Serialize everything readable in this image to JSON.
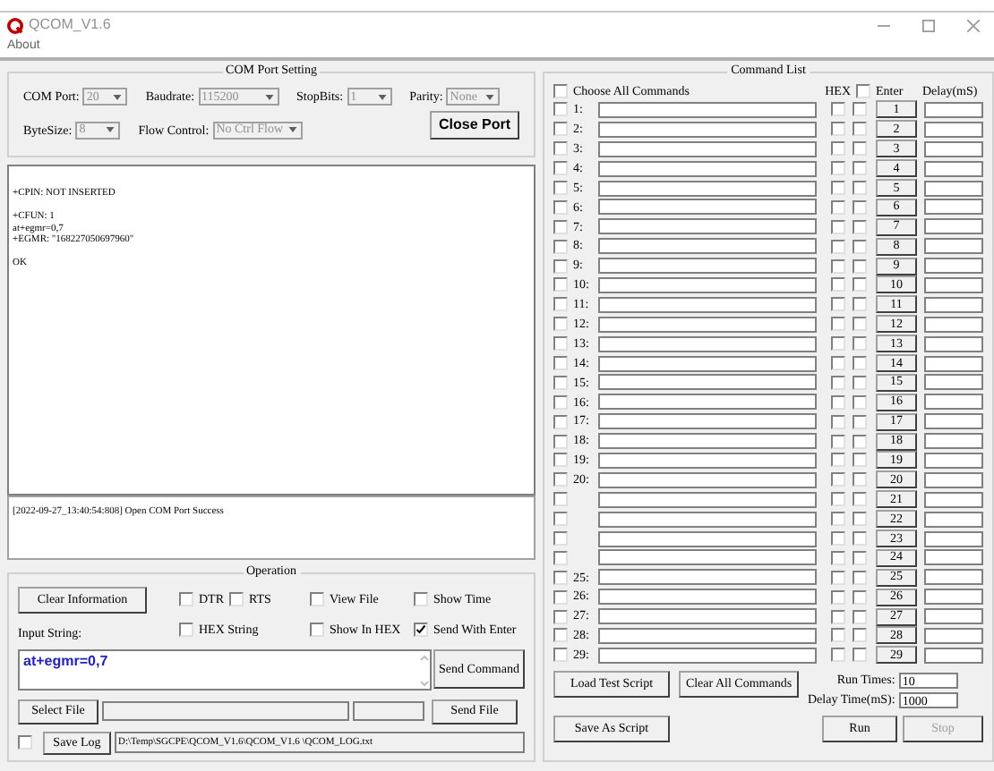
{
  "window": {
    "title": "QCOM_V1.6",
    "menu": [
      "About"
    ]
  },
  "com_port_setting": {
    "title": "COM Port Setting",
    "row1": [
      {
        "label": "COM Port:",
        "value": "20"
      },
      {
        "label": "Baudrate:",
        "value": "115200"
      },
      {
        "label": "StopBits:",
        "value": "1"
      },
      {
        "label": "Parity:",
        "value": "None"
      }
    ],
    "row2": [
      {
        "label": "ByteSize:",
        "value": "8"
      },
      {
        "label": "Flow Control:",
        "value": "No Ctrl Flow"
      }
    ],
    "close_button": "Close Port"
  },
  "output_blocks": [
    [
      "+CPIN: NOT INSERTED"
    ],
    [
      "+CFUN: 1",
      "at+egmr=0,7",
      "+EGMR: \"168227050697960\""
    ],
    [
      "OK"
    ]
  ],
  "log": "[2022-09-27_13:40:54:808] Open COM Port Success",
  "operation": {
    "title": "Operation",
    "clear_button": "Clear Information",
    "option_rows": [
      [
        {
          "label": "DTR",
          "checked": false
        },
        {
          "label": "RTS",
          "checked": false
        },
        {
          "label": "View File",
          "checked": false
        },
        {
          "label": "Show Time",
          "checked": false
        }
      ],
      [
        {
          "label": "HEX String",
          "checked": false
        },
        {
          "label": "Show In HEX",
          "checked": false
        },
        {
          "label": "Send With Enter",
          "checked": true
        }
      ]
    ],
    "input_label": "Input String:",
    "input_value": "at+egmr=0,7",
    "send_command": "Send Command",
    "select_file": "Select File",
    "send_file": "Send File",
    "save_log": {
      "label": "Save Log",
      "checked": false
    },
    "log_path": "D:\\Temp\\SGCPE\\QCOM_V1.6\\QCOM_V1.6 \\QCOM_LOG.txt"
  },
  "command_list": {
    "title": "Command List",
    "choose_all": {
      "label": "Choose All Commands",
      "checked": false
    },
    "hex_label": "HEX",
    "enter": {
      "label": "Enter",
      "checked": false
    },
    "delay_label": "Delay(mS)",
    "rows": [
      {
        "label": "1:",
        "checked": false,
        "hex": false,
        "enter": false,
        "button": "1"
      },
      {
        "label": "2:",
        "checked": false,
        "hex": false,
        "enter": false,
        "button": "2"
      },
      {
        "label": "3:",
        "checked": false,
        "hex": false,
        "enter": false,
        "button": "3"
      },
      {
        "label": "4:",
        "checked": false,
        "hex": false,
        "enter": false,
        "button": "4"
      },
      {
        "label": "5:",
        "checked": false,
        "hex": false,
        "enter": false,
        "button": "5"
      },
      {
        "label": "6:",
        "checked": false,
        "hex": false,
        "enter": false,
        "button": "6"
      },
      {
        "label": "7:",
        "checked": false,
        "hex": false,
        "enter": false,
        "button": "7"
      },
      {
        "label": "8:",
        "checked": false,
        "hex": false,
        "enter": false,
        "button": "8"
      },
      {
        "label": "9:",
        "checked": false,
        "hex": false,
        "enter": false,
        "button": "9"
      },
      {
        "label": "10:",
        "checked": false,
        "hex": false,
        "enter": false,
        "button": "10"
      },
      {
        "label": "11:",
        "checked": false,
        "hex": false,
        "enter": false,
        "button": "11"
      },
      {
        "label": "12:",
        "checked": false,
        "hex": false,
        "enter": false,
        "button": "12"
      },
      {
        "label": "13:",
        "checked": false,
        "hex": false,
        "enter": false,
        "button": "13"
      },
      {
        "label": "14:",
        "checked": false,
        "hex": false,
        "enter": false,
        "button": "14"
      },
      {
        "label": "15:",
        "checked": false,
        "hex": false,
        "enter": false,
        "button": "15"
      },
      {
        "label": "16:",
        "checked": false,
        "hex": false,
        "enter": false,
        "button": "16"
      },
      {
        "label": "17:",
        "checked": false,
        "hex": false,
        "enter": false,
        "button": "17"
      },
      {
        "label": "18:",
        "checked": false,
        "hex": false,
        "enter": false,
        "button": "18"
      },
      {
        "label": "19:",
        "checked": false,
        "hex": false,
        "enter": false,
        "button": "19"
      },
      {
        "label": "20:",
        "checked": false,
        "hex": false,
        "enter": false,
        "button": "20"
      },
      {
        "checked": false,
        "hex": false,
        "enter": false,
        "button": "21"
      },
      {
        "checked": false,
        "hex": false,
        "enter": false,
        "button": "22"
      },
      {
        "checked": false,
        "hex": false,
        "enter": false,
        "button": "23"
      },
      {
        "checked": false,
        "hex": false,
        "enter": false,
        "button": "24"
      },
      {
        "label": "25:",
        "checked": false,
        "hex": false,
        "enter": false,
        "button": "25"
      },
      {
        "label": "26:",
        "checked": false,
        "hex": false,
        "enter": false,
        "button": "26"
      },
      {
        "label": "27:",
        "checked": false,
        "hex": false,
        "enter": false,
        "button": "27"
      },
      {
        "label": "28:",
        "checked": false,
        "hex": false,
        "enter": false,
        "button": "28"
      },
      {
        "label": "29:",
        "checked": false,
        "hex": false,
        "enter": false,
        "button": "29"
      }
    ],
    "load_button": "Load Test Script",
    "clear_all_button": "Clear All Commands",
    "run_times_label": "Run Times:",
    "run_times": "10",
    "delay_time_label": "Delay Time(mS):",
    "delay_time": "1000",
    "save_as_button": "Save As Script",
    "run_button": "Run",
    "stop_button": {
      "label": "Stop",
      "disabled": true
    }
  }
}
